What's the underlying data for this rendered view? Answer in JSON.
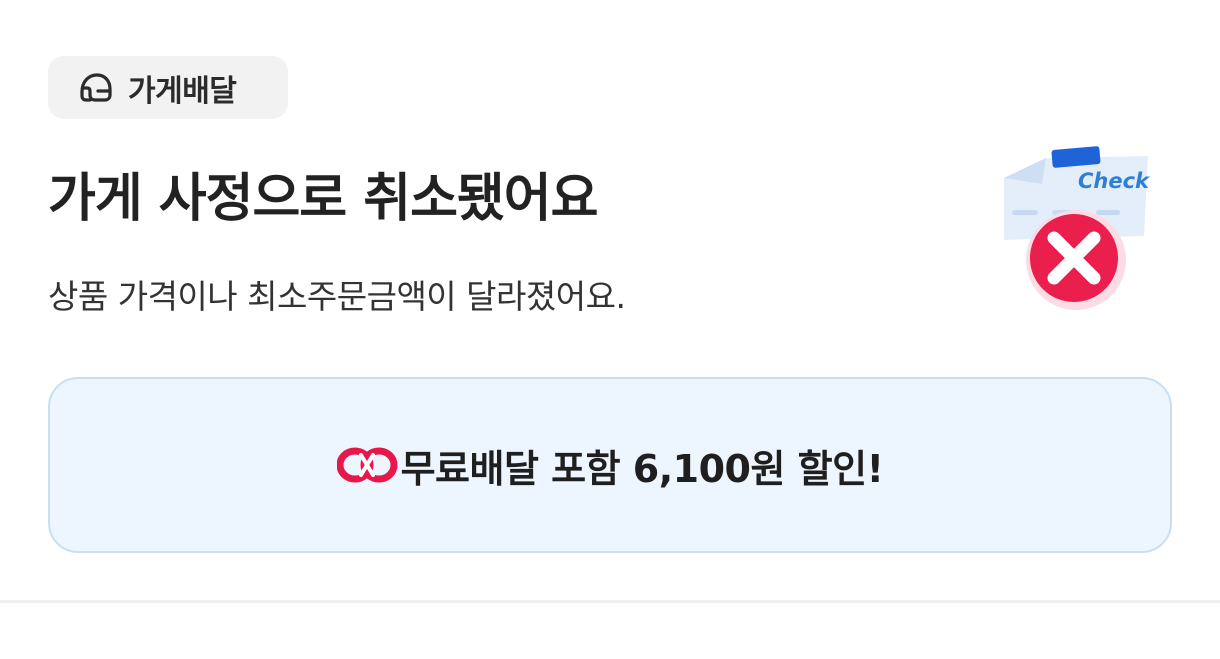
{
  "chip": {
    "icon": "helmet-icon",
    "label": "가게배달"
  },
  "header": {
    "title": "가게 사정으로 취소됐어요",
    "subtitle": "상품 가격이나 최소주문금액이 달라졌어요."
  },
  "illustration": {
    "icon": "cancelled-check-icon",
    "check_text": "Check"
  },
  "banner": {
    "icon": "free-delivery-logo-icon",
    "text": "무료배달 포함 6,100원 할인!"
  },
  "colors": {
    "banner_background": "#edf5fe",
    "banner_border": "#c9dff0",
    "cancel_red": "#ea1f4e",
    "check_blue": "#2f7fd6",
    "chip_background": "#f2f2f2"
  }
}
